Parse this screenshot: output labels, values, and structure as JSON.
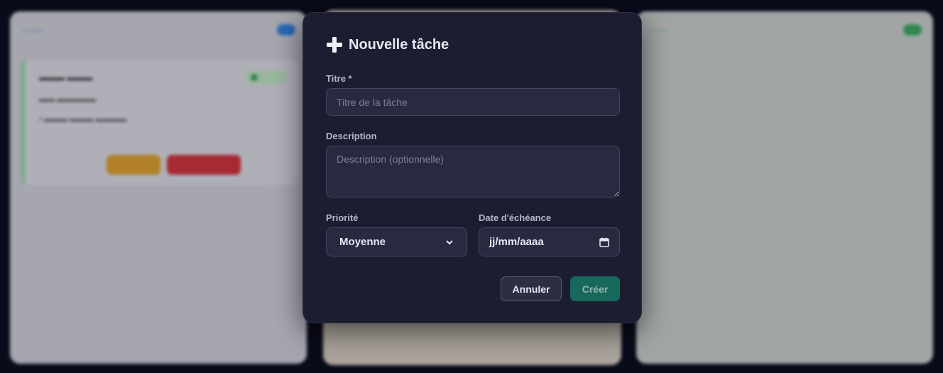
{
  "modal": {
    "title": "Nouvelle tâche",
    "title_icon": "plus-icon",
    "fields": {
      "title": {
        "label": "Titre *",
        "placeholder": "Titre de la tâche",
        "value": ""
      },
      "description": {
        "label": "Description",
        "placeholder": "Description (optionnelle)",
        "value": ""
      },
      "priority": {
        "label": "Priorité",
        "selected": "Moyenne",
        "icon": "chevron-down-icon"
      },
      "due_date": {
        "label": "Date d'échéance",
        "value": "jj/mm/aaaa",
        "icon": "calendar-icon"
      }
    },
    "buttons": {
      "cancel": "Annuler",
      "create": "Créer"
    }
  },
  "colors": {
    "modal_bg": "#1c1d30",
    "input_bg": "#292a40",
    "create_button": "#17695c",
    "accent_blue": "#2f7ed6",
    "accent_green": "#3aa35c"
  }
}
